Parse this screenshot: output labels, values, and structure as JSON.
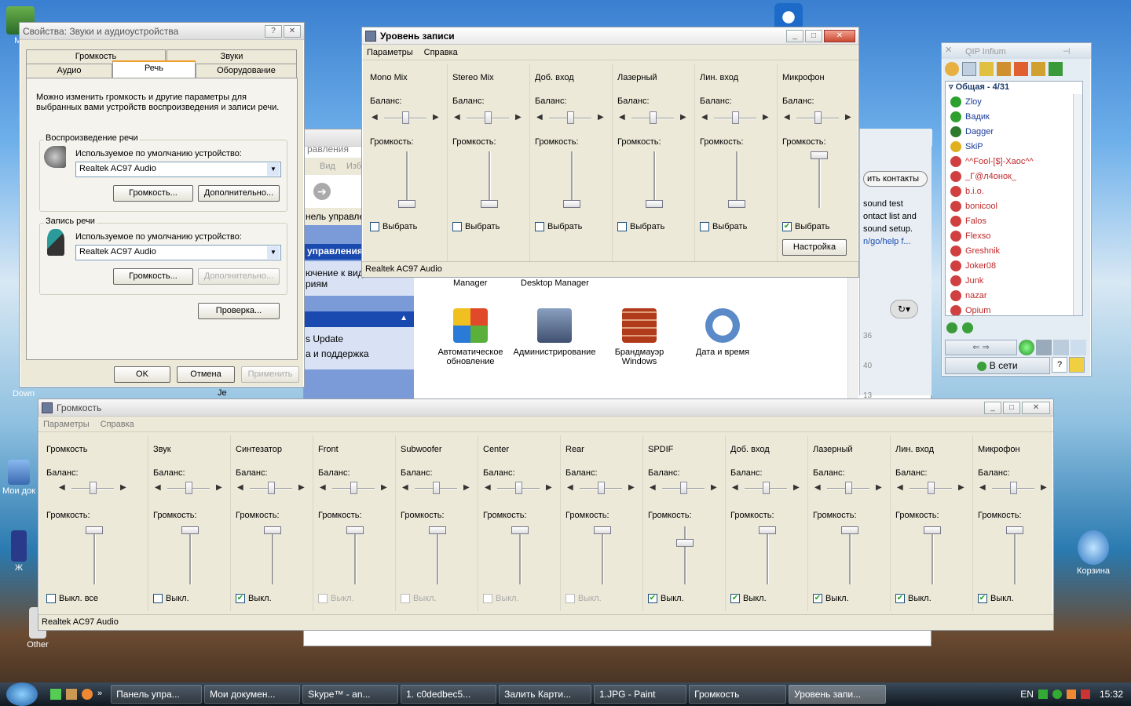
{
  "desktop_icons": {
    "mo": "Мо",
    "down": "Down",
    "moi_dok": "Мои док",
    "zh": "Ж",
    "other": "Other",
    "recycle": "Корзина"
  },
  "sound_props": {
    "title": "Свойства: Звуки и аудиоустройства",
    "tabs_top": [
      "Громкость",
      "Звуки"
    ],
    "tabs_bottom": [
      "Аудио",
      "Речь",
      "Оборудование"
    ],
    "desc": "Можно изменить громкость и другие параметры для выбранных вами устройств воспроизведения и записи речи.",
    "playback_group": "Воспроизведение речи",
    "default_device_label": "Используемое по умолчанию устройство:",
    "playback_device": "Realtek AC97 Audio",
    "volume_btn": "Громкость...",
    "advanced_btn": "Дополнительно...",
    "record_group": "Запись речи",
    "record_device": "Realtek AC97 Audio",
    "test_btn": "Проверка...",
    "ok": "OK",
    "cancel": "Отмена",
    "apply": "Применить"
  },
  "record_level": {
    "title": "Уровень записи",
    "menu": [
      "Параметры",
      "Справка"
    ],
    "balance_label": "Баланс:",
    "volume_label": "Громкость:",
    "select_label": "Выбрать",
    "settings_btn": "Настройка",
    "status": "Realtek AC97 Audio",
    "channels": [
      {
        "name": "Mono Mix",
        "selected": false,
        "volume": 0
      },
      {
        "name": "Stereo Mix",
        "selected": false,
        "volume": 0
      },
      {
        "name": "Доб. вход",
        "selected": false,
        "volume": 0
      },
      {
        "name": "Лазерный",
        "selected": false,
        "volume": 0
      },
      {
        "name": "Лин. вход",
        "selected": false,
        "volume": 0
      },
      {
        "name": "Микрофон",
        "selected": true,
        "volume": 1
      }
    ]
  },
  "volume_ctrl": {
    "title": "Громкость",
    "menu": [
      "Параметры",
      "Справка"
    ],
    "balance_label": "Баланс:",
    "volume_label": "Громкость:",
    "mute_all": "Выкл. все",
    "mute_label": "Выкл.",
    "status": "Realtek AC97 Audio",
    "channels": [
      {
        "name": "Громкость",
        "muted": false,
        "disabled": false,
        "volume": 1
      },
      {
        "name": "Звук",
        "muted": false,
        "disabled": false,
        "volume": 1
      },
      {
        "name": "Синтезатор",
        "muted": true,
        "disabled": false,
        "volume": 1
      },
      {
        "name": "Front",
        "muted": false,
        "disabled": true,
        "volume": 1
      },
      {
        "name": "Subwoofer",
        "muted": false,
        "disabled": true,
        "volume": 1
      },
      {
        "name": "Center",
        "muted": false,
        "disabled": true,
        "volume": 1
      },
      {
        "name": "Rear",
        "muted": false,
        "disabled": true,
        "volume": 1
      },
      {
        "name": "SPDIF",
        "muted": true,
        "disabled": false,
        "volume": 0.75
      },
      {
        "name": "Доб. вход",
        "muted": true,
        "disabled": false,
        "volume": 1
      },
      {
        "name": "Лазерный",
        "muted": true,
        "disabled": false,
        "volume": 1
      },
      {
        "name": "Лин. вход",
        "muted": true,
        "disabled": false,
        "volume": 1
      },
      {
        "name": "Микрофон",
        "muted": true,
        "disabled": false,
        "volume": 1
      }
    ]
  },
  "control_panel": {
    "menu_view": "Вид",
    "menu_fav": "Избр",
    "address_frag": "нель управлен",
    "header_frag": "равления",
    "side_title": "управления",
    "side_text": "ючение к вид",
    "side_text2": "риям",
    "update_link": "s Update",
    "support_link": "а и поддержка",
    "contacts_btn": "ить контакты",
    "sound_test_lines": [
      "sound test",
      "ontact list and",
      "sound setup.",
      "n/go/help f..."
    ],
    "top_labels": [
      "Manager",
      "Desktop Manager"
    ],
    "icons": [
      {
        "label": "Автоматическое обновление"
      },
      {
        "label": "Администрирование"
      },
      {
        "label": "Брандмауэр Windows"
      },
      {
        "label": "Дата и время"
      }
    ],
    "numbers": [
      "36",
      "40",
      "13"
    ],
    "je": "Je"
  },
  "qip": {
    "title": "QIP Infium",
    "group": "Общая - 4/31",
    "contacts": [
      {
        "name": "Zloy",
        "color": "#1a3a9a",
        "status": "#2ea02e"
      },
      {
        "name": "Вадик",
        "color": "#1a3a9a",
        "status": "#2ea02e"
      },
      {
        "name": "Dagger",
        "color": "#1a3a9a",
        "status": "#2e7a2e"
      },
      {
        "name": "SkiP",
        "color": "#1a3a9a",
        "status": "#e0b020"
      },
      {
        "name": "^^Fool-[$]-Хаос^^",
        "color": "#c0282a",
        "status": "#d04040"
      },
      {
        "name": "_Г@л4онок_",
        "color": "#c0282a",
        "status": "#d04040"
      },
      {
        "name": "b.i.o.",
        "color": "#c0282a",
        "status": "#d04040"
      },
      {
        "name": "bonicool",
        "color": "#c0282a",
        "status": "#d04040"
      },
      {
        "name": "Falos",
        "color": "#c0282a",
        "status": "#d04040"
      },
      {
        "name": "Flexso",
        "color": "#c0282a",
        "status": "#d04040"
      },
      {
        "name": "Greshnik",
        "color": "#c0282a",
        "status": "#d04040"
      },
      {
        "name": "Joker08",
        "color": "#c0282a",
        "status": "#d04040"
      },
      {
        "name": "Junk",
        "color": "#c0282a",
        "status": "#d04040"
      },
      {
        "name": "nazar",
        "color": "#c0282a",
        "status": "#d04040"
      },
      {
        "name": "Opium",
        "color": "#c0282a",
        "status": "#d04040"
      }
    ],
    "status_btn": "В сети"
  },
  "taskbar": {
    "items": [
      "Панель упра...",
      "Мои докумен...",
      "Skype™ - an...",
      "1. c0dedbec5...",
      "Залить Карти...",
      "1.JPG - Paint",
      "Громкость",
      "Уровень запи..."
    ],
    "lang": "EN",
    "clock": "15:32"
  }
}
